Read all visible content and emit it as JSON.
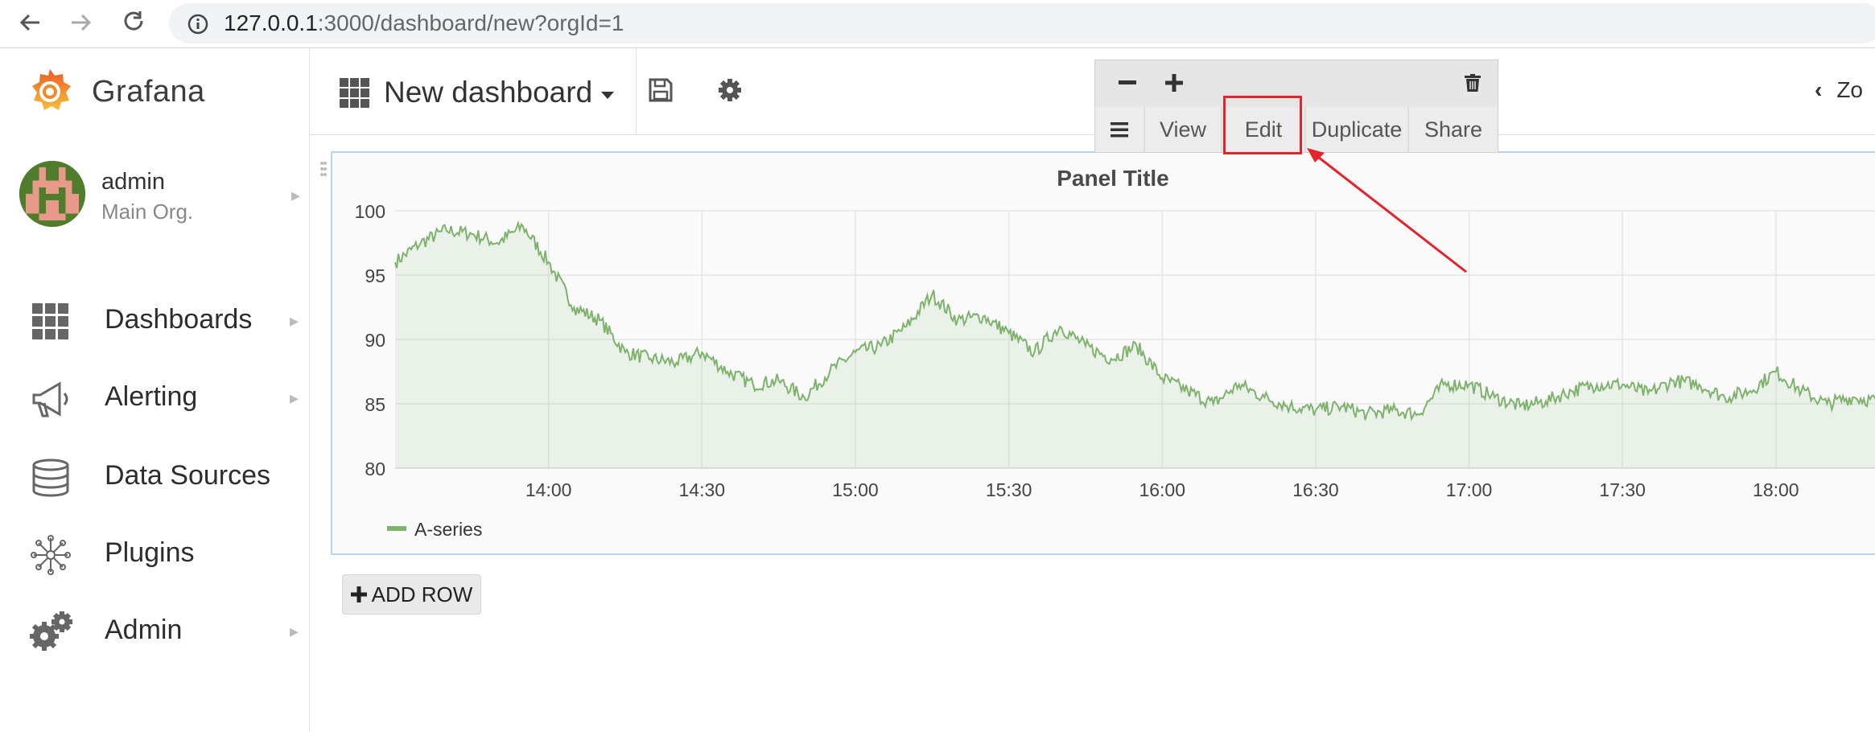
{
  "browser": {
    "url_host": "127.0.0.1",
    "url_rest": ":3000/dashboard/new?orgId=1"
  },
  "sidebar": {
    "logo_text": "Grafana",
    "user": {
      "name": "admin",
      "org": "Main Org."
    },
    "items": [
      {
        "label": "Dashboards",
        "icon": "dashboards-grid-icon",
        "has_submenu": true
      },
      {
        "label": "Alerting",
        "icon": "megaphone-icon",
        "has_submenu": true
      },
      {
        "label": "Data Sources",
        "icon": "database-icon",
        "has_submenu": false
      },
      {
        "label": "Plugins",
        "icon": "plugins-icon",
        "has_submenu": false
      },
      {
        "label": "Admin",
        "icon": "gears-icon",
        "has_submenu": true
      }
    ]
  },
  "header": {
    "dashboard_title": "New dashboard",
    "zoom_label": "Zo"
  },
  "panel_menu": {
    "top_icons": [
      "minus-icon",
      "plus-icon",
      "trash-icon"
    ],
    "items": [
      "View",
      "Edit",
      "Duplicate",
      "Share"
    ],
    "highlighted": "Edit"
  },
  "panel": {
    "title": "Panel Title"
  },
  "add_row_label": "ADD ROW",
  "colors": {
    "series": "#7eb26d",
    "annotation": "#e4232b",
    "panel_border": "#b9d3ef"
  },
  "chart_data": {
    "type": "area",
    "title": "Panel Title",
    "ylim": [
      80,
      100
    ],
    "y_ticks": [
      100,
      95,
      90,
      85,
      80
    ],
    "x_ticks": [
      "14:00",
      "14:30",
      "15:00",
      "15:30",
      "16:00",
      "16:30",
      "17:00",
      "17:30",
      "18:00"
    ],
    "x_range": [
      "13:30",
      "18:23"
    ],
    "series": [
      {
        "name": "A-series",
        "x": [
          "13:30",
          "13:35",
          "13:40",
          "13:45",
          "13:50",
          "13:55",
          "14:00",
          "14:05",
          "14:10",
          "14:15",
          "14:20",
          "14:25",
          "14:30",
          "14:35",
          "14:40",
          "14:45",
          "14:50",
          "14:55",
          "15:00",
          "15:05",
          "15:10",
          "15:15",
          "15:20",
          "15:25",
          "15:30",
          "15:35",
          "15:40",
          "15:45",
          "15:50",
          "15:55",
          "16:00",
          "16:05",
          "16:10",
          "16:15",
          "16:20",
          "16:25",
          "16:30",
          "16:35",
          "16:40",
          "16:45",
          "16:50",
          "16:55",
          "17:00",
          "17:05",
          "17:10",
          "17:15",
          "17:20",
          "17:25",
          "17:30",
          "17:35",
          "17:40",
          "17:45",
          "17:50",
          "17:55",
          "18:00",
          "18:05",
          "18:10",
          "18:15",
          "18:20"
        ],
        "y": [
          96,
          97.5,
          98.5,
          98.2,
          97.5,
          98.8,
          96,
          92.5,
          91.5,
          89,
          88.5,
          88.2,
          89,
          87.5,
          86.5,
          86.8,
          85.5,
          87.5,
          89,
          89.5,
          91,
          93.5,
          91.5,
          91.8,
          90.5,
          89,
          91,
          89.5,
          88.5,
          89.5,
          87,
          86,
          85,
          86.5,
          85.5,
          84.8,
          84.5,
          84.8,
          84.2,
          84.5,
          84.2,
          86.5,
          86.5,
          85.5,
          84.8,
          85.2,
          86,
          86.5,
          86.5,
          85.8,
          86.8,
          86.5,
          85.5,
          86,
          87.5,
          86,
          85,
          85.5,
          85.2
        ]
      }
    ],
    "legend": "bottom-left",
    "grid": true
  }
}
